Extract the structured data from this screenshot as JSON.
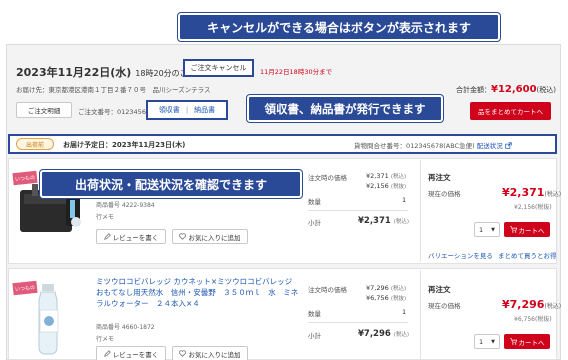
{
  "callouts": {
    "cancel": "キャンセルができる場合はボタンが表示されます",
    "documents": "領収書、納品書が発行できます",
    "status": "出荷状況・配送状況を確認できます"
  },
  "order": {
    "date": "2023年11月22日(水)",
    "time_note": "18時20分のご注文",
    "cancel_button": "ご注文キャンセル",
    "cancel_deadline": "11月22日18時30分まで",
    "ship_to": "お届け先：東京都港区港南１丁目２番７０号　品川シーズンテラス",
    "total_label": "合計金額：",
    "total_value": "¥12,600",
    "total_suffix": "(税込)",
    "detail_button": "ご注文明細",
    "order_number": "ご注文番号：0123456789",
    "receipt_link": "領収書",
    "invoice_link": "納品書",
    "cart_all_button": "品をまとめてカートへ"
  },
  "shipment": {
    "status_badge": "出荷前",
    "delivery_date": "お届け予定日：2023年11月23日(木)",
    "tracking_label": "貨物問合せ番号：012345678(ABC急便)",
    "tracking_link": "配送状況",
    "tracking_icon": "external-link-icon"
  },
  "items": [
    {
      "tag": "いつもの",
      "code": "商品番号 4222-9384",
      "memo": "行メモ",
      "review_button": "レビューを書く",
      "favorite_button": "お気に入りに追加",
      "order_price_label": "注文時の価格",
      "order_price_tax": "¥2,371",
      "order_price_notax": "¥2,156",
      "tax_in": "(税込)",
      "tax_out": "(税抜)",
      "qty_label": "数量",
      "qty_value": "1",
      "subtotal_label": "小計",
      "subtotal_value": "¥2,371",
      "reorder_title": "再注文",
      "current_price_label": "現在の価格",
      "current_price": "¥2,371",
      "current_price_notax": "¥2,156",
      "qty_select": "1",
      "cart_button": "カートへ",
      "variation_link": "バリエーションを見る",
      "buy_together_link": "まとめて買うとお得"
    },
    {
      "tag": "いつもの",
      "name": "ミツウロコビバレッジ カウネット×ミツウロコビバレッジ おもてなし用天然水　信州・安曇野　３５０ｍｌ　水　ミネラルウォーター　２４本入×４",
      "code": "商品番号 4660-1872",
      "memo": "行メモ",
      "review_button": "レビューを書く",
      "favorite_button": "お気に入りに追加",
      "order_price_label": "注文時の価格",
      "order_price_tax": "¥7,296",
      "order_price_notax": "¥6,756",
      "tax_in": "(税込)",
      "tax_out": "(税抜)",
      "qty_label": "数量",
      "qty_value": "1",
      "subtotal_label": "小計",
      "subtotal_value": "¥7,296",
      "reorder_title": "再注文",
      "current_price_label": "現在の価格",
      "current_price": "¥7,296",
      "current_price_notax": "¥6,756",
      "qty_select": "1",
      "cart_button": "カートへ"
    }
  ],
  "colors": {
    "callout": "#2a4a97",
    "accent_red": "#d0021b",
    "link_blue": "#1a55b5"
  }
}
